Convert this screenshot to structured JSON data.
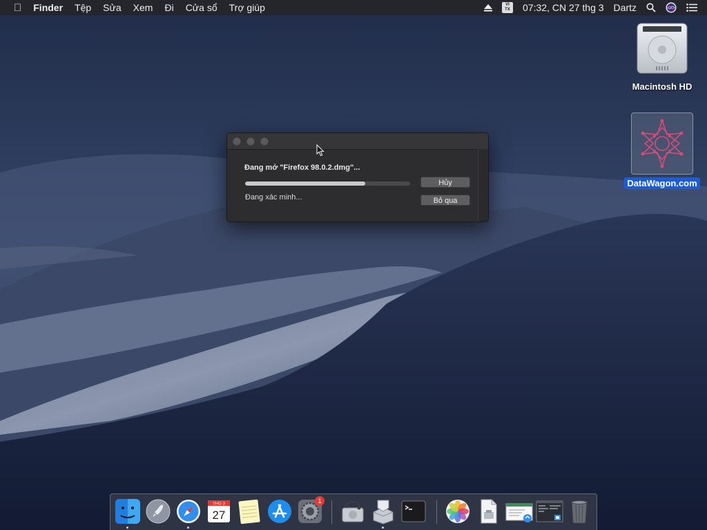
{
  "menubar": {
    "apple_icon": "apple-icon",
    "app_name": "Finder",
    "menus": [
      "Tệp",
      "Sửa",
      "Xem",
      "Đi",
      "Cửa sổ",
      "Trợ giúp"
    ],
    "input_source": "VI\nTX",
    "clock": "07:32, CN 27 thg 3",
    "user": "Dartz"
  },
  "desktop": {
    "icons": [
      {
        "label": "Macintosh HD",
        "icon": "hard-drive-icon"
      },
      {
        "label": "DataWagon.com",
        "icon": "datawagon-image-icon",
        "selected": true
      }
    ]
  },
  "dialog": {
    "title": "Đang mở \"Firefox 98.0.2.dmg\"...",
    "status": "Đang xác minh...",
    "progress": 0.73,
    "cancel_label": "Hủy",
    "skip_label": "Bỏ qua"
  },
  "dock": {
    "calendar_month": "THG 3",
    "calendar_day": "27",
    "prefs_badge": "1",
    "items": [
      "finder-icon",
      "launchpad-icon",
      "safari-icon",
      "calendar-icon",
      "notes-icon",
      "app-store-icon",
      "system-preferences-icon",
      "disk-utility-icon",
      "installer-icon",
      "terminal-icon",
      "photos-icon",
      "preview-document-icon",
      "certificate-document-icon",
      "screenshot-thumbnail-icon",
      "trash-icon"
    ]
  },
  "colors": {
    "menubar_bg": "#26262a",
    "dialog_bg": "#2d2d2f",
    "selection_blue": "#1d5cd8",
    "badge_red": "#e53b30"
  }
}
